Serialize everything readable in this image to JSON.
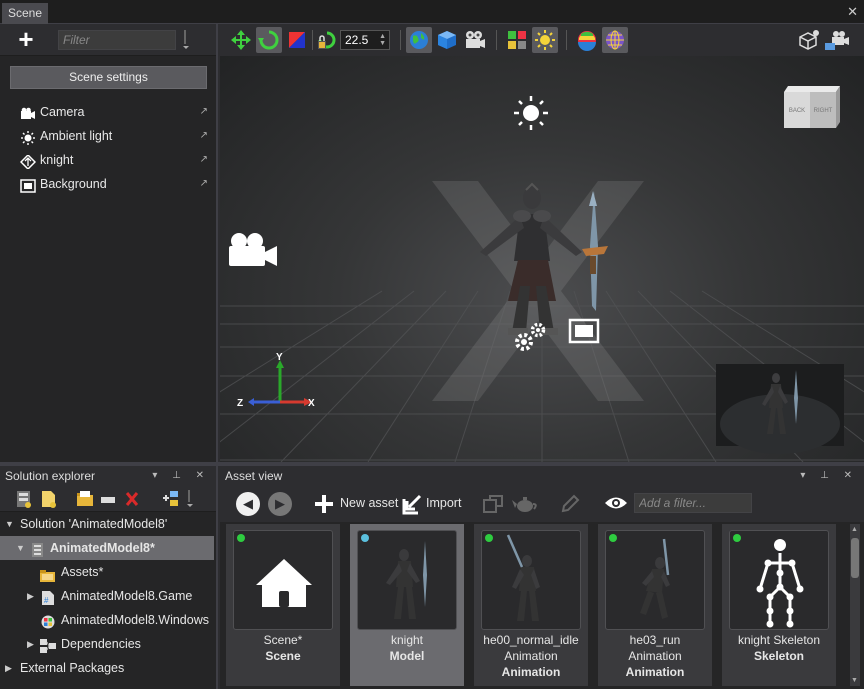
{
  "window": {
    "tab_title": "Scene",
    "close_symbol": "✕"
  },
  "scene_panel": {
    "add_symbol": "+",
    "filter_placeholder": "Filter",
    "settings_button": "Scene settings",
    "entities": [
      {
        "label": "Camera",
        "icon": "camera-icon"
      },
      {
        "label": "Ambient light",
        "icon": "ambient-light-icon"
      },
      {
        "label": "knight",
        "icon": "entity-icon"
      },
      {
        "label": "Background",
        "icon": "background-icon"
      }
    ]
  },
  "toolbar": {
    "snap_value": "22.5"
  },
  "viewport": {
    "axis_y": "Y",
    "axis_x": "X",
    "axis_z": "Z",
    "cube_back": "BACK",
    "cube_right": "RIGHT"
  },
  "solution_explorer": {
    "title": "Solution explorer",
    "tree": {
      "solution": "Solution 'AnimatedModel8'",
      "project": "AnimatedModel8*",
      "assets": "Assets*",
      "game": "AnimatedModel8.Game",
      "windows": "AnimatedModel8.Windows",
      "dependencies": "Dependencies",
      "external": "External Packages"
    }
  },
  "asset_view": {
    "title": "Asset view",
    "new_asset": "New asset",
    "import": "Import",
    "filter_placeholder": "Add a filter...",
    "assets": [
      {
        "name": "Scene*",
        "subtype": "",
        "type": "Scene",
        "status": "green"
      },
      {
        "name": "knight",
        "subtype": "",
        "type": "Model",
        "status": "blue"
      },
      {
        "name": "he00_normal_idle",
        "subtype": "Animation",
        "type": "Animation",
        "status": "green"
      },
      {
        "name": "he03_run",
        "subtype": "Animation",
        "type": "Animation",
        "status": "green"
      },
      {
        "name": "knight Skeleton",
        "subtype": "",
        "type": "Skeleton",
        "status": "green"
      }
    ]
  },
  "colors": {
    "accent_green": "#2ecc40",
    "accent_blue": "#5bc0de",
    "axis_x": "#d63a2f",
    "axis_y": "#2aa82a",
    "axis_z": "#3a5fd6"
  }
}
